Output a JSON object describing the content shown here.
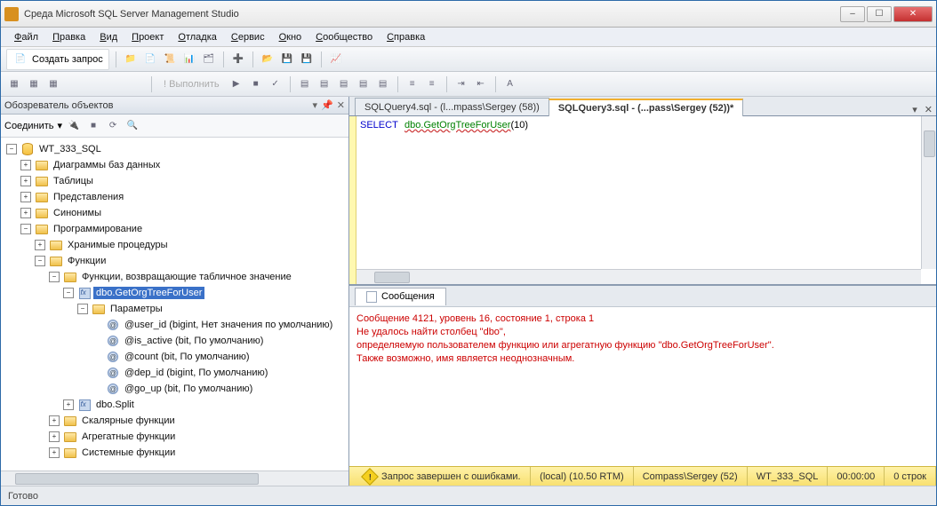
{
  "window": {
    "title": "Среда Microsoft SQL Server Management Studio"
  },
  "menu": {
    "items": [
      {
        "u": "Ф",
        "rest": "айл"
      },
      {
        "u": "П",
        "rest": "равка"
      },
      {
        "u": "В",
        "rest": "ид"
      },
      {
        "u": "П",
        "rest": "роект"
      },
      {
        "u": "О",
        "rest": "тладка"
      },
      {
        "u": "С",
        "rest": "ервис"
      },
      {
        "u": "О",
        "rest": "кно"
      },
      {
        "u": "С",
        "rest": "ообщество"
      },
      {
        "u": "С",
        "rest": "правка"
      }
    ]
  },
  "toolbar": {
    "new_query": "Создать запрос",
    "execute": "Выполнить"
  },
  "object_explorer": {
    "title": "Обозреватель объектов",
    "connect": "Соединить",
    "root": "WT_333_SQL",
    "nodes": {
      "diagrams": "Диаграммы баз данных",
      "tables": "Таблицы",
      "views": "Представления",
      "synonyms": "Синонимы",
      "programmability": "Программирование",
      "stored_procs": "Хранимые процедуры",
      "functions": "Функции",
      "table_valued": "Функции, возвращающие табличное значение",
      "sel_fn": "dbo.GetOrgTreeForUser",
      "params_folder": "Параметры",
      "params": [
        "@user_id (bigint, Нет значения по умолчанию)",
        "@is_active (bit, По умолчанию)",
        "@count (bit, По умолчанию)",
        "@dep_id (bigint, По умолчанию)",
        "@go_up (bit, По умолчанию)"
      ],
      "dbo_split": "dbo.Split",
      "scalar_fn": "Скалярные функции",
      "aggregate_fn": "Агрегатные функции",
      "system_fn": "Системные функции"
    }
  },
  "tabs": {
    "inactive": "SQLQuery4.sql - (l...mpass\\Sergey (58))",
    "active": "SQLQuery3.sql - (...pass\\Sergey (52))*"
  },
  "editor": {
    "kw": "SELECT",
    "fn": "dbo.GetOrgTreeForUser",
    "arg": "(10)"
  },
  "messages": {
    "tab": "Сообщения",
    "lines": [
      "Сообщение 4121, уровень 16, состояние 1, строка 1",
      "Не удалось найти столбец \"dbo\",",
      "определяемую пользователем функцию или агрегатную функцию \"dbo.GetOrgTreeForUser\".",
      "Также возможно, имя является неоднозначным."
    ]
  },
  "status": {
    "msg": "Запрос завершен с ошибками.",
    "server": "(local) (10.50 RTM)",
    "user": "Compass\\Sergey (52)",
    "db": "WT_333_SQL",
    "time": "00:00:00",
    "rows": "0 строк"
  },
  "footer": "Готово"
}
